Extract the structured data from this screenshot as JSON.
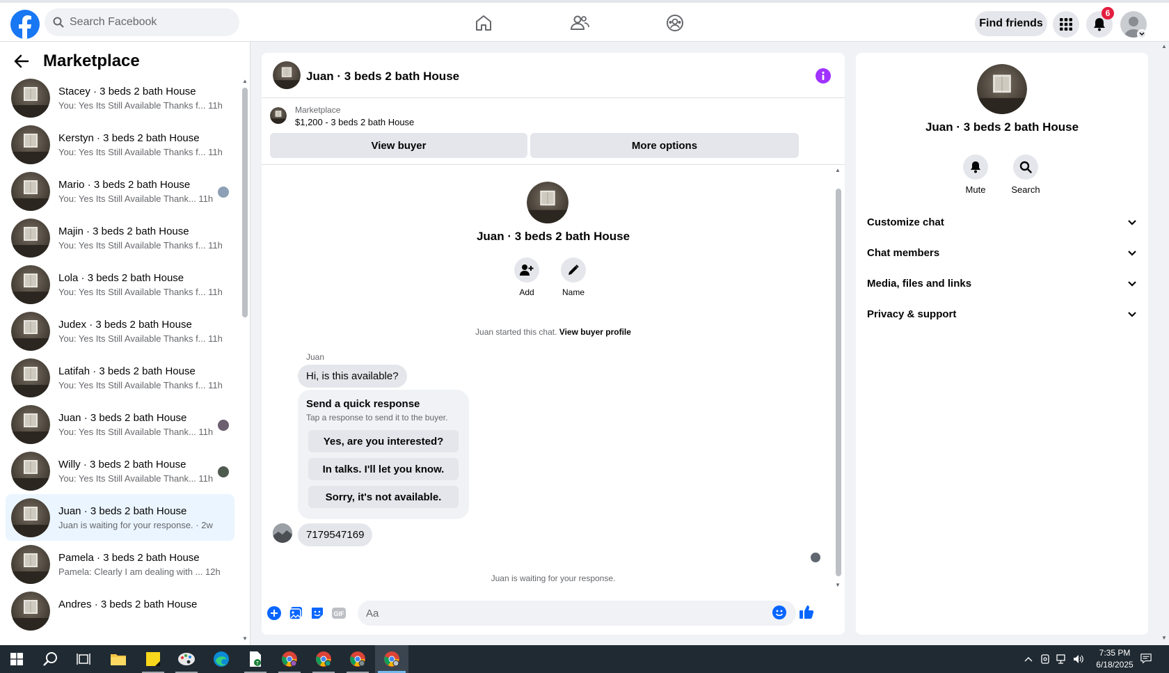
{
  "topbar": {
    "search_placeholder": "Search Facebook",
    "find_friends": "Find friends",
    "notification_count": "6"
  },
  "sidebar": {
    "title": "Marketplace",
    "conversations": [
      {
        "name": "Stacey · 3 beds 2 bath House",
        "preview": "You: Yes Its Still Available Thanks f...",
        "time": "11h",
        "seen": "none"
      },
      {
        "name": "Kerstyn · 3 beds 2 bath House",
        "preview": "You: Yes Its Still Available Thanks f...",
        "time": "11h",
        "seen": "none"
      },
      {
        "name": "Mario · 3 beds 2 bath House",
        "preview": "You: Yes Its Still Available Thank...",
        "time": "11h",
        "seen": "avatar"
      },
      {
        "name": "Majin · 3 beds 2 bath House",
        "preview": "You: Yes Its Still Available Thanks f...",
        "time": "11h",
        "seen": "none"
      },
      {
        "name": "Lola · 3 beds 2 bath House",
        "preview": "You: Yes Its Still Available Thanks f...",
        "time": "11h",
        "seen": "none"
      },
      {
        "name": "Judex · 3 beds 2 bath House",
        "preview": "You: Yes Its Still Available Thanks f...",
        "time": "11h",
        "seen": "none"
      },
      {
        "name": "Latifah · 3 beds 2 bath House",
        "preview": "You: Yes Its Still Available Thanks f...",
        "time": "11h",
        "seen": "none"
      },
      {
        "name": "Juan · 3 beds 2 bath House",
        "preview": "You: Yes Its Still Available Thank...",
        "time": "11h",
        "seen": "avatar"
      },
      {
        "name": "Willy · 3 beds 2 bath House",
        "preview": "You: Yes Its Still Available Thank...",
        "time": "11h",
        "seen": "avatar"
      },
      {
        "name": "Juan · 3 beds 2 bath House",
        "preview": "Juan is waiting for your response.",
        "time": "2w",
        "seen": "none",
        "active": true
      },
      {
        "name": "Pamela · 3 beds 2 bath House",
        "preview": "Pamela: Clearly I am dealing with ...",
        "time": "12h",
        "seen": "none"
      },
      {
        "name": "Andres · 3 beds 2 bath House",
        "preview": "",
        "time": "",
        "seen": "none"
      }
    ]
  },
  "chat": {
    "header_name": "Juan · 3 beds 2 bath House",
    "marketplace_label": "Marketplace",
    "listing": "$1,200 - 3 beds 2 bath House",
    "view_buyer": "View buyer",
    "more_options": "More options",
    "contact_name": "Juan · 3 beds 2 bath House",
    "add_label": "Add",
    "name_label": "Name",
    "started_text": "Juan started this chat.",
    "view_buyer_profile": "View buyer profile",
    "sender": "Juan",
    "first_message": "Hi, is this available?",
    "quick_response_title": "Send a quick response",
    "quick_response_sub": "Tap a response to send it to the buyer.",
    "quick_responses": [
      "Yes, are you interested?",
      "In talks. I'll let you know.",
      "Sorry, it's not available."
    ],
    "phone_message": "7179547169",
    "waiting_text": "Juan is waiting for your response.",
    "composer_placeholder": "Aa"
  },
  "rpanel": {
    "name": "Juan · 3 beds 2 bath House",
    "mute": "Mute",
    "search": "Search",
    "sections": [
      "Customize chat",
      "Chat members",
      "Media, files and links",
      "Privacy & support"
    ]
  },
  "taskbar": {
    "time": "7:35 PM",
    "date": "6/18/2025"
  },
  "colors": {
    "brand": "#1877f2",
    "info": "#a033ff",
    "active_row": "#ebf5ff",
    "badge": "#e41e3f"
  }
}
